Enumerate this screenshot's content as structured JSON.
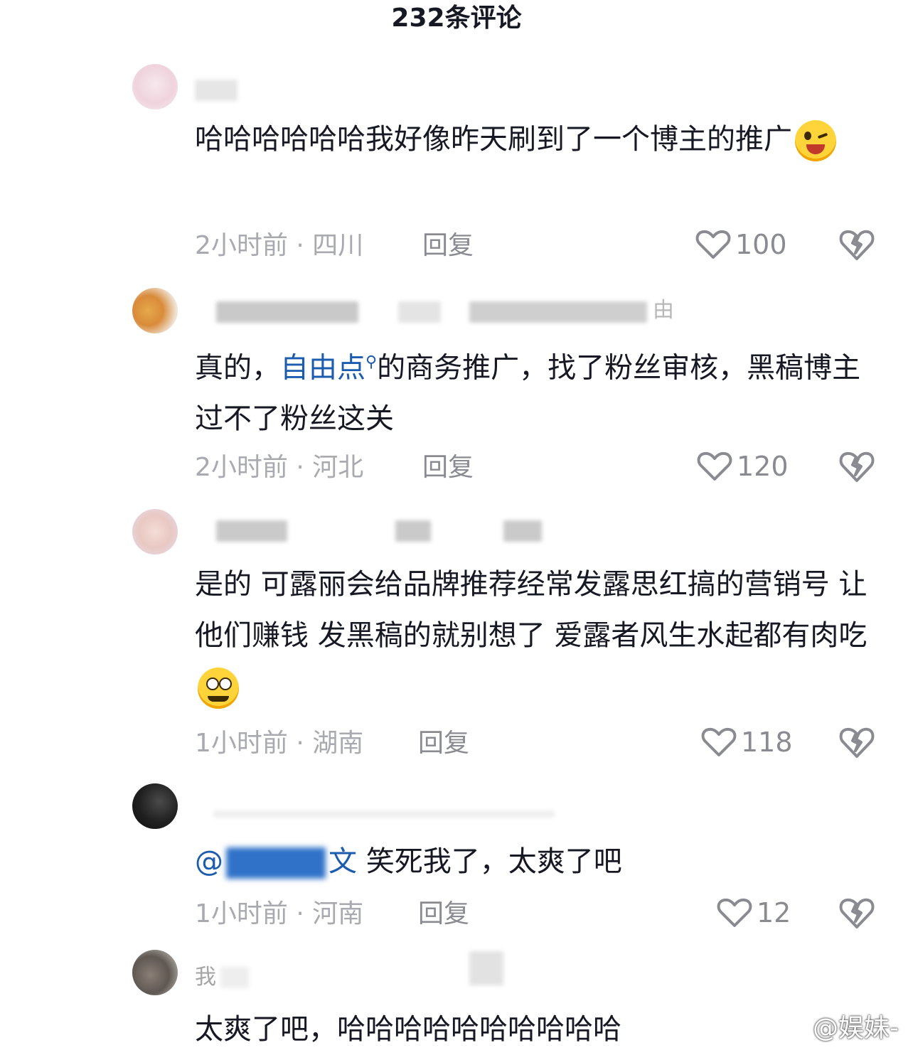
{
  "header": {
    "title": "232条评论"
  },
  "comments": [
    {
      "name": "",
      "text": "哈哈哈哈哈哈我好像昨天刷到了一个博主的推广",
      "time_location": "2小时前 · 四川",
      "reply": "回复",
      "likes": "100"
    },
    {
      "name": "由",
      "text_before": "真的，",
      "mention": "自由点",
      "text_after": "的商务推广，找了粉丝审核，黑稿博主过不了粉丝这关",
      "time_location": "2小时前 · 河北",
      "reply": "回复",
      "likes": "120"
    },
    {
      "name": "",
      "text": "是的 可露丽会给品牌推荐经常发露思红搞的营销号 让他们赚钱 发黑稿的就别想了 爱露者风生水起都有肉吃",
      "time_location": "1小时前 · 湖南",
      "reply": "回复",
      "likes": "118"
    },
    {
      "name": "",
      "at": "@",
      "mention_tail": "文",
      "text": "笑死我了，太爽了吧",
      "time_location": "1小时前 · 河南",
      "reply": "回复",
      "likes": "12"
    },
    {
      "name": "我",
      "text": "太爽了吧，哈哈哈哈哈哈哈哈哈哈"
    }
  ],
  "watermark": {
    "text": "@娱妹-"
  },
  "icons": {
    "like": "heart-icon",
    "dislike": "broken-heart-icon",
    "search_hint": "search-icon",
    "weibo": "weibo-icon"
  }
}
